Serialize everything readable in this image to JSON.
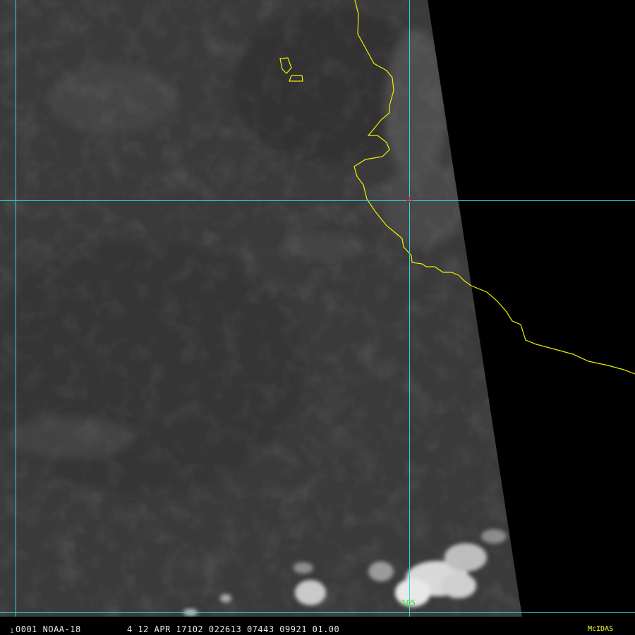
{
  "status": {
    "frame_number": "1",
    "text_left": "0001 NOAA-18",
    "text_right": "4 12 APR 17102 022613 07443 09921 01.00",
    "brand": "McIDAS"
  },
  "grid_labels": {
    "lat": "30",
    "lon": "105"
  },
  "colors": {
    "grid": "#2fd6e0",
    "coastline": "#f0f000",
    "lat_label": "#b02020",
    "lon_label": "#20e020",
    "brand": "#ffff33"
  },
  "color_bar": {
    "gray_steps": [
      "#000000",
      "#101010",
      "#1c1c1c",
      "#262626",
      "#303030",
      "#3a3a3a",
      "#444444",
      "#4f4f4f",
      "#5a5a5a",
      "#656565",
      "#707070",
      "#7b7b7b",
      "#868686",
      "#929292",
      "#9e9e9e",
      "#aaaaaa",
      "#b6b6b6",
      "#c2c2c2",
      "#cecece",
      "#dadada",
      "#e6e6e6",
      "#f2f2f2",
      "#ffffff"
    ],
    "color_steps": [
      "#cfeff0",
      "#a8dcdc",
      "#a0b8b8",
      "#8a9a9a",
      "#7a7a7a",
      "#5a5a5a",
      "#000099",
      "#0000dd",
      "#009900",
      "#00dd00",
      "#880000",
      "#cc0000",
      "#dd6600",
      "#eeee00",
      "#999900",
      "#aaaaaa",
      "#dddddd",
      "#555555",
      "#222244",
      "#000044"
    ]
  }
}
